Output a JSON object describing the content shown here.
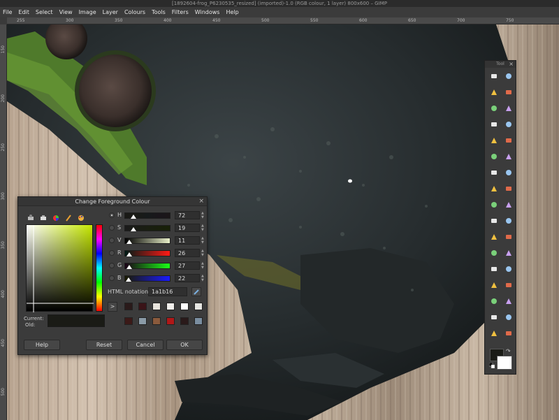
{
  "window_title": "[1892604-frog_P6230535_resized] (imported)-1.0 (RGB colour, 1 layer) 800x600 – GIMP",
  "menu": [
    "File",
    "Edit",
    "Select",
    "View",
    "Image",
    "Layer",
    "Colours",
    "Tools",
    "Filters",
    "Windows",
    "Help"
  ],
  "ruler_labels": [
    "255",
    "300",
    "350",
    "400",
    "450",
    "500",
    "550",
    "600",
    "650",
    "700",
    "750"
  ],
  "vruler_labels": [
    "150",
    "200",
    "250",
    "300",
    "350",
    "400",
    "450",
    "500",
    "550",
    "600"
  ],
  "dialog": {
    "title": "Change Foreground Colour",
    "sliders": [
      {
        "label": "H",
        "value": "72",
        "selected": true,
        "fill": 0.2
      },
      {
        "label": "S",
        "value": "19",
        "selected": false,
        "fill": 0.19
      },
      {
        "label": "V",
        "value": "11",
        "selected": false,
        "fill": 0.11
      },
      {
        "label": "R",
        "value": "26",
        "selected": false,
        "fill": 0.1
      },
      {
        "label": "G",
        "value": "27",
        "selected": false,
        "fill": 0.1
      },
      {
        "label": "B",
        "value": "22",
        "selected": false,
        "fill": 0.09
      }
    ],
    "html_label": "HTML notation:",
    "html_value": "1a1b16",
    "current_label": "Current:",
    "old_label": "Old:",
    "current_color": "#1a1b16",
    "history_colors": [
      "#2a1a1a",
      "#3a1418",
      "#e8e4dc",
      "#f2f0ec",
      "#ffffff",
      "#e6e6e2",
      "#3b1a18",
      "#8a9aa6",
      "#8a5a3c",
      "#b01818",
      "#2a1a1a",
      "#7a8ea0"
    ],
    "buttons": {
      "help": "Help",
      "reset": "Reset",
      "cancel": "Cancel",
      "ok": "OK"
    }
  },
  "toolbox": {
    "title": "Tool",
    "fg_color": "#1a1b16",
    "bg_color": "#ffffff",
    "tools": [
      "rect-select-icon",
      "ellipse-select-icon",
      "lasso-icon",
      "fuzzy-select-icon",
      "color-select-icon",
      "scissors-icon",
      "foreground-select-icon",
      "paths-icon",
      "color-picker-icon",
      "zoom-icon",
      "measure-icon",
      "move-icon",
      "align-icon",
      "crop-icon",
      "rotate-icon",
      "scale-icon",
      "shear-icon",
      "perspective-icon",
      "flip-icon",
      "cage-icon",
      "text-icon",
      "bucket-fill-icon",
      "gradient-icon",
      "pencil-icon",
      "paintbrush-icon",
      "eraser-icon",
      "airbrush-icon",
      "ink-icon",
      "clone-icon",
      "heal-icon",
      "perspective-clone-icon",
      "smudge-icon",
      "blur-icon",
      "dodge-icon"
    ]
  }
}
